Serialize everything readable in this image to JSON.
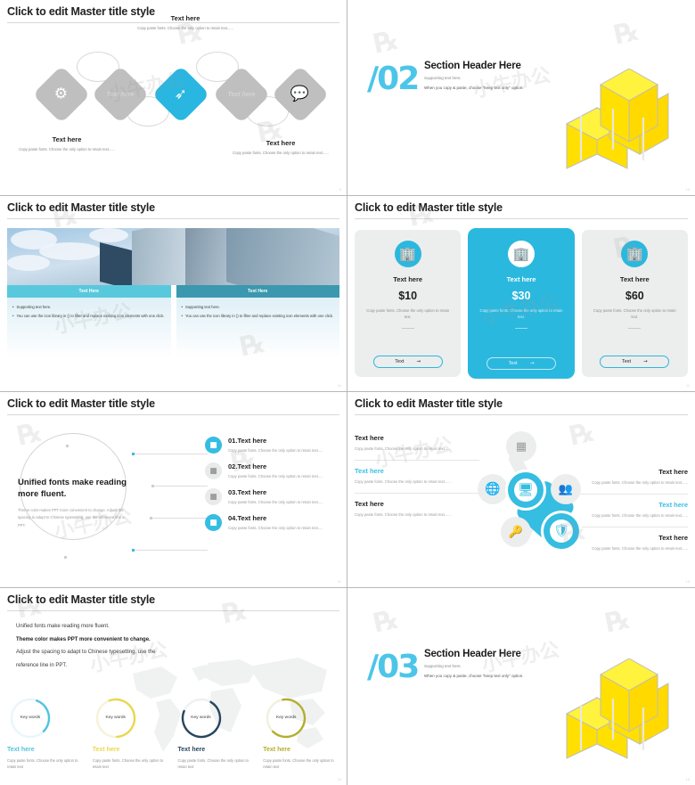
{
  "master_title": "Click to edit Master title style",
  "slides": [
    {
      "id": "process-diamonds",
      "title": "Click to edit Master title style",
      "page": "9",
      "nodes": [
        {
          "icon": "settings-gear-icon",
          "glyph": "⚙",
          "active": false,
          "label": ""
        },
        {
          "icon": "text-placeholder-icon",
          "glyph": "",
          "active": false,
          "label": "Text here"
        },
        {
          "icon": "click-target-icon",
          "glyph": "➴",
          "active": true,
          "label": ""
        },
        {
          "icon": "text-placeholder-icon",
          "glyph": "",
          "active": false,
          "label": "Text here"
        },
        {
          "icon": "chat-bubble-icon",
          "glyph": "ὊC",
          "active": false,
          "label": ""
        }
      ],
      "callouts": [
        {
          "title": "Text here",
          "body": "Copy paste fonts. Choose the only option to retain text......"
        },
        {
          "title": "Text here",
          "body": "Copy paste fonts. Choose the only option to retain text......"
        },
        {
          "title": "Text here",
          "body": "Copy paste fonts. Choose the only option to retain text......"
        }
      ]
    },
    {
      "id": "section-header-02",
      "number": "/02",
      "heading": "Section Header Here",
      "sub1": "Supporting text here.",
      "sub2": "When you copy & paste, choose \"keep text only\" option.",
      "page": "10"
    },
    {
      "id": "photo-two-panels",
      "title": "Click to edit Master title style",
      "page": "10",
      "panels": [
        {
          "bar": "Text Here",
          "bullets": [
            "Supporting text here.",
            "You can use the icon library in  () to filter and replace existing icon elements with one click."
          ]
        },
        {
          "bar": "Text Here",
          "bullets": [
            "Supporting text here.",
            "You can use the icon library in  () to filter and replace existing icon elements with one click."
          ]
        }
      ]
    },
    {
      "id": "pricing-cards",
      "title": "Click to edit Master title style",
      "page": "11",
      "cards": [
        {
          "icon": "building-icon",
          "title": "Text here",
          "price": "$10",
          "desc": "Copy paste fonts. Choose the only option to retain text.",
          "button": "Text",
          "featured": false
        },
        {
          "icon": "building-icon",
          "title": "Text here",
          "price": "$30",
          "desc": "Copy paste fonts. Choose the only option to retain text.",
          "button": "Text",
          "featured": true
        },
        {
          "icon": "building-icon",
          "title": "Text here",
          "price": "$60",
          "desc": "Copy paste fonts. Choose the only option to retain text.",
          "button": "Text",
          "featured": false
        }
      ]
    },
    {
      "id": "circle-numbered-list",
      "title": "Click to edit Master title style",
      "page": "11",
      "headline": "Unified fonts make reading more fluent.",
      "subtext": "Theme color makes PPT more convenient to change. Adjust the spacing to adapt to Chinese typesetting, use the reference line in PPT.",
      "items": [
        {
          "num": "01.",
          "label": "Text here",
          "body": "Copy paste fonts. Choose the only option to retain text.....",
          "active": true
        },
        {
          "num": "02.",
          "label": "Text here",
          "body": "Copy paste fonts. Choose the only option to retain text.....",
          "active": false
        },
        {
          "num": "03.",
          "label": "Text here",
          "body": "Copy paste fonts. Choose the only option to retain text.....",
          "active": false
        },
        {
          "num": "04.",
          "label": "Text here",
          "body": "Copy paste fonts. Choose the only option to retain text.....",
          "active": true
        }
      ]
    },
    {
      "id": "network-nodes",
      "title": "Click to edit Master title style",
      "page": "13",
      "left": [
        {
          "label": "Text here",
          "accent": false,
          "body": "Copy paste fonts. Choose the only option to retain text......"
        },
        {
          "label": "Text here",
          "accent": true,
          "body": "Copy paste fonts. Choose the only option to retain text......"
        },
        {
          "label": "Text here",
          "accent": false,
          "body": "Copy paste fonts. Choose the only option to retain text......"
        }
      ],
      "right": [
        {
          "label": "Text here",
          "accent": false,
          "body": "Copy paste fonts. Choose the only option to retain text......"
        },
        {
          "label": "Text here",
          "accent": true,
          "body": "Copy paste fonts. Choose the only option to retain text......"
        },
        {
          "label": "Text here",
          "accent": false,
          "body": "Copy paste fonts. Choose the only option to retain text......"
        }
      ],
      "nodes": [
        {
          "icon": "sitemap-icon",
          "glyph": "⚇",
          "active": false
        },
        {
          "icon": "globe-icon",
          "glyph": "⊕",
          "active": false
        },
        {
          "icon": "monitor-globe-icon",
          "glyph": "⊙",
          "active": true
        },
        {
          "icon": "user-settings-icon",
          "glyph": "⛭",
          "active": false
        },
        {
          "icon": "key-icon",
          "glyph": "⚷",
          "active": false
        },
        {
          "icon": "shield-check-icon",
          "glyph": "⬟",
          "active": true
        }
      ]
    },
    {
      "id": "world-map-donuts",
      "title": "Click to edit Master title style",
      "page": "14",
      "paragraph": [
        {
          "text": "Unified fonts make reading more fluent.",
          "bold": false
        },
        {
          "text": "Theme color makes PPT more convenient to change.",
          "bold": true
        },
        {
          "text": "Adjust the spacing to adapt to Chinese typesetting, use the",
          "bold": false
        },
        {
          "text": "reference line in PPT.",
          "bold": false
        }
      ],
      "donuts": [
        {
          "keyword": "Key words",
          "title": "Text here",
          "color": "#52c3e0",
          "percent": 32,
          "body": "Copy paste fonts. Choose the only option to retain text"
        },
        {
          "keyword": "Key words",
          "title": "Text here",
          "color": "#ead750",
          "percent": 55,
          "body": "Copy paste fonts. Choose the only option to retain text"
        },
        {
          "keyword": "Key words",
          "title": "Text here",
          "color": "#27465e",
          "percent": 72,
          "body": "Copy paste fonts. Choose the only option to retain text"
        },
        {
          "keyword": "Key words",
          "title": "Text here",
          "color": "#b3ae2e",
          "percent": 65,
          "body": "Copy paste fonts. Choose the only option to retain text"
        }
      ]
    },
    {
      "id": "section-header-03",
      "number": "/03",
      "heading": "Section Header Here",
      "sub1": "Supporting text here.",
      "sub2": "When you copy & paste, choose \"keep text only\" option.",
      "page": "15"
    }
  ],
  "colors": {
    "accent": "#35bde2",
    "accent_light": "#58c8dd",
    "accent_dark": "#3b98ae",
    "yellow": "#ffe000",
    "gray": "#bfbfbf"
  },
  "watermark": "小牛办公"
}
